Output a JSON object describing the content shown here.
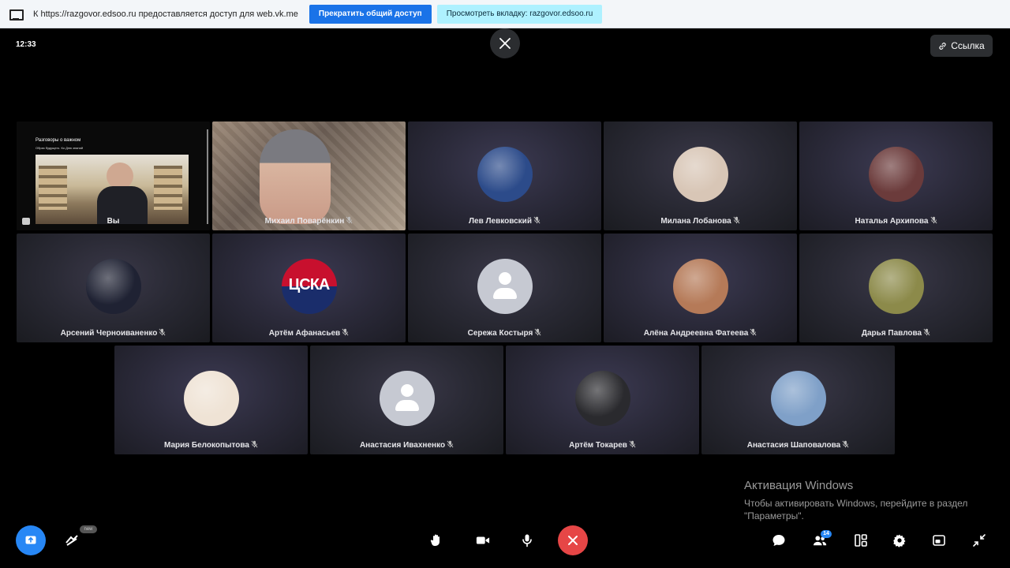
{
  "share_bar": {
    "message": "К https://razgovor.edsoo.ru предоставляется доступ для web.vk.me",
    "stop_label": "Прекратить общий доступ",
    "view_label": "Просмотреть вкладку: razgovor.edsoo.ru"
  },
  "header": {
    "time": "12:33",
    "link_label": "Ссылка"
  },
  "self_tile": {
    "name": "Вы",
    "slide_title": "Разговоры о важном",
    "slide_subtitle": "Образ будущего. Ко Дню знаний"
  },
  "participants": [
    {
      "name": "Михаил Поварёнкин",
      "avatar": "video"
    },
    {
      "name": "Лев Левковский",
      "avatar": "photo",
      "color": "#2c4b8a"
    },
    {
      "name": "Милана Лобанова",
      "avatar": "photo",
      "color": "#d8c6b6"
    },
    {
      "name": "Наталья Архипова",
      "avatar": "photo",
      "color": "#6b3b3b"
    },
    {
      "name": "Арсений Черноиваненко",
      "avatar": "photo",
      "color": "#1f2233"
    },
    {
      "name": "Артём Афанасьев",
      "avatar": "cska"
    },
    {
      "name": "Сережа Костыря",
      "avatar": "placeholder"
    },
    {
      "name": "Алёна Андреевна Фатеева",
      "avatar": "photo",
      "color": "#b57a58"
    },
    {
      "name": "Дарья Павлова",
      "avatar": "photo",
      "color": "#8c8a4a"
    },
    {
      "name": "Мария Белокопытова",
      "avatar": "photo",
      "color": "#efe3d5"
    },
    {
      "name": "Анастасия Ивахненко",
      "avatar": "placeholder"
    },
    {
      "name": "Артём Токарев",
      "avatar": "photo",
      "color": "#2a2a2e"
    },
    {
      "name": "Анастасия Шаповалова",
      "avatar": "photo",
      "color": "#7fa0c8"
    }
  ],
  "activation": {
    "title": "Активация Windows",
    "text": "Чтобы активировать Windows, перейдите в раздел \"Параметры\"."
  },
  "toolbar": {
    "participants_count": "14",
    "effects_badge": "new"
  },
  "colors": {
    "accent": "#2787f5",
    "end_call": "#e64646",
    "stop_button": "#1a73e8",
    "view_button": "#aef1ff"
  }
}
